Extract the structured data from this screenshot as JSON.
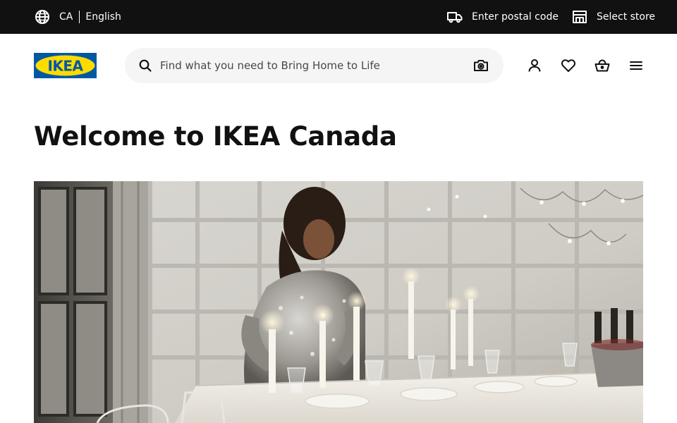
{
  "topbar": {
    "country": "CA",
    "language": "English",
    "postal_label": "Enter postal code",
    "store_label": "Select store",
    "background": "#111111"
  },
  "header": {
    "logo_text": "IKEA",
    "search_placeholder": "Find what you need to Bring Home to Life",
    "search_value": "",
    "icons": [
      "search-icon",
      "camera-icon",
      "profile-icon",
      "heart-icon",
      "shopping-bag-icon",
      "menu-icon"
    ]
  },
  "brand": {
    "blue": "#0058a3",
    "yellow": "#ffdb00"
  },
  "main": {
    "title": "Welcome to IKEA Canada",
    "hero_image": "woman-setting-candlelit-table-image"
  }
}
